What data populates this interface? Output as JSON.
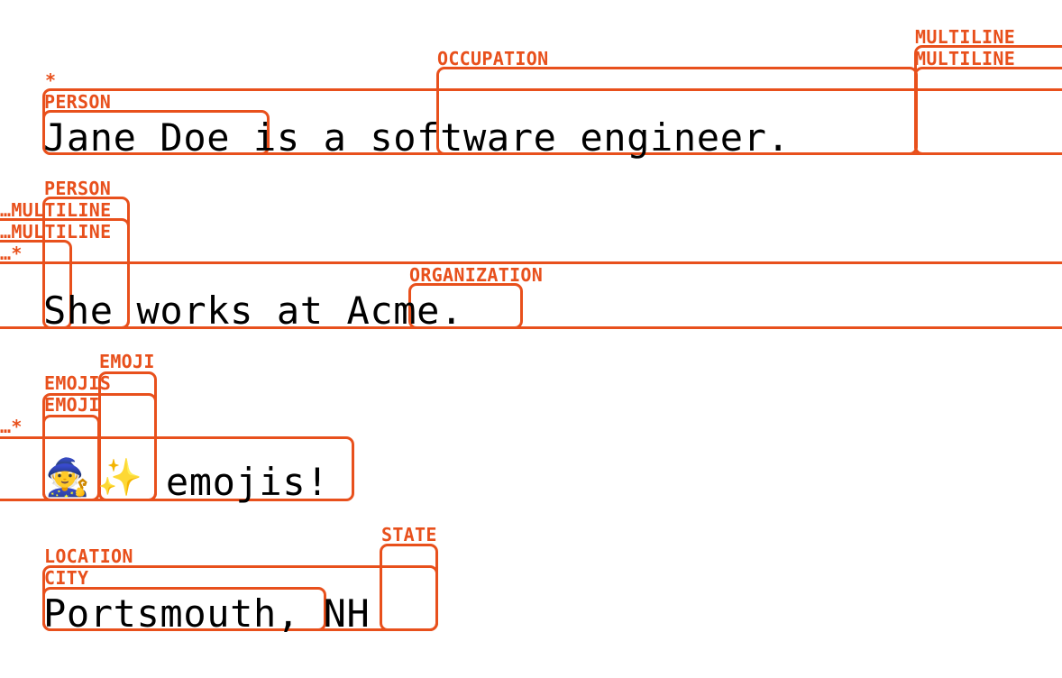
{
  "sentences": {
    "line1": "Jane Doe is a software engineer.",
    "line2": "She works at Acme.",
    "line3_text": " emojis!",
    "line4": "Portsmouth, NH"
  },
  "emojis": {
    "mage": "🧙",
    "sparkles": "✨"
  },
  "labels": {
    "star1": "*",
    "person1": "PERSON",
    "occupation": "OCCUPATION",
    "multiline_a": "MULTILINE",
    "multiline_b": "MULTILINE",
    "person2": "PERSON",
    "multiline_cont_a": "…MULTILINE",
    "multiline_cont_b": "…MULTILINE",
    "star_cont2": "…*",
    "organization": "ORGANIZATION",
    "emoji_top": "EMOJI",
    "emojis": "EMOJIS",
    "emoji_first": "EMOJI",
    "star_cont3": "…*",
    "state": "STATE",
    "location": "LOCATION",
    "city": "CITY"
  },
  "colors": {
    "annotation": "#e8501c",
    "text": "#000000",
    "background": "#ffffff"
  }
}
